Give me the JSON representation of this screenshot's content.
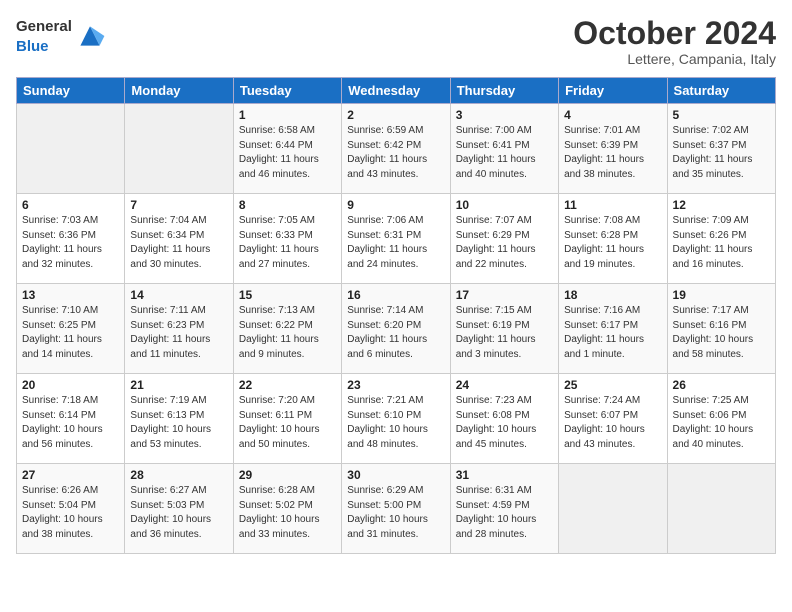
{
  "header": {
    "logo_general": "General",
    "logo_blue": "Blue",
    "month": "October 2024",
    "location": "Lettere, Campania, Italy"
  },
  "days_of_week": [
    "Sunday",
    "Monday",
    "Tuesday",
    "Wednesday",
    "Thursday",
    "Friday",
    "Saturday"
  ],
  "weeks": [
    [
      {
        "num": "",
        "info": ""
      },
      {
        "num": "",
        "info": ""
      },
      {
        "num": "1",
        "info": "Sunrise: 6:58 AM\nSunset: 6:44 PM\nDaylight: 11 hours and 46 minutes."
      },
      {
        "num": "2",
        "info": "Sunrise: 6:59 AM\nSunset: 6:42 PM\nDaylight: 11 hours and 43 minutes."
      },
      {
        "num": "3",
        "info": "Sunrise: 7:00 AM\nSunset: 6:41 PM\nDaylight: 11 hours and 40 minutes."
      },
      {
        "num": "4",
        "info": "Sunrise: 7:01 AM\nSunset: 6:39 PM\nDaylight: 11 hours and 38 minutes."
      },
      {
        "num": "5",
        "info": "Sunrise: 7:02 AM\nSunset: 6:37 PM\nDaylight: 11 hours and 35 minutes."
      }
    ],
    [
      {
        "num": "6",
        "info": "Sunrise: 7:03 AM\nSunset: 6:36 PM\nDaylight: 11 hours and 32 minutes."
      },
      {
        "num": "7",
        "info": "Sunrise: 7:04 AM\nSunset: 6:34 PM\nDaylight: 11 hours and 30 minutes."
      },
      {
        "num": "8",
        "info": "Sunrise: 7:05 AM\nSunset: 6:33 PM\nDaylight: 11 hours and 27 minutes."
      },
      {
        "num": "9",
        "info": "Sunrise: 7:06 AM\nSunset: 6:31 PM\nDaylight: 11 hours and 24 minutes."
      },
      {
        "num": "10",
        "info": "Sunrise: 7:07 AM\nSunset: 6:29 PM\nDaylight: 11 hours and 22 minutes."
      },
      {
        "num": "11",
        "info": "Sunrise: 7:08 AM\nSunset: 6:28 PM\nDaylight: 11 hours and 19 minutes."
      },
      {
        "num": "12",
        "info": "Sunrise: 7:09 AM\nSunset: 6:26 PM\nDaylight: 11 hours and 16 minutes."
      }
    ],
    [
      {
        "num": "13",
        "info": "Sunrise: 7:10 AM\nSunset: 6:25 PM\nDaylight: 11 hours and 14 minutes."
      },
      {
        "num": "14",
        "info": "Sunrise: 7:11 AM\nSunset: 6:23 PM\nDaylight: 11 hours and 11 minutes."
      },
      {
        "num": "15",
        "info": "Sunrise: 7:13 AM\nSunset: 6:22 PM\nDaylight: 11 hours and 9 minutes."
      },
      {
        "num": "16",
        "info": "Sunrise: 7:14 AM\nSunset: 6:20 PM\nDaylight: 11 hours and 6 minutes."
      },
      {
        "num": "17",
        "info": "Sunrise: 7:15 AM\nSunset: 6:19 PM\nDaylight: 11 hours and 3 minutes."
      },
      {
        "num": "18",
        "info": "Sunrise: 7:16 AM\nSunset: 6:17 PM\nDaylight: 11 hours and 1 minute."
      },
      {
        "num": "19",
        "info": "Sunrise: 7:17 AM\nSunset: 6:16 PM\nDaylight: 10 hours and 58 minutes."
      }
    ],
    [
      {
        "num": "20",
        "info": "Sunrise: 7:18 AM\nSunset: 6:14 PM\nDaylight: 10 hours and 56 minutes."
      },
      {
        "num": "21",
        "info": "Sunrise: 7:19 AM\nSunset: 6:13 PM\nDaylight: 10 hours and 53 minutes."
      },
      {
        "num": "22",
        "info": "Sunrise: 7:20 AM\nSunset: 6:11 PM\nDaylight: 10 hours and 50 minutes."
      },
      {
        "num": "23",
        "info": "Sunrise: 7:21 AM\nSunset: 6:10 PM\nDaylight: 10 hours and 48 minutes."
      },
      {
        "num": "24",
        "info": "Sunrise: 7:23 AM\nSunset: 6:08 PM\nDaylight: 10 hours and 45 minutes."
      },
      {
        "num": "25",
        "info": "Sunrise: 7:24 AM\nSunset: 6:07 PM\nDaylight: 10 hours and 43 minutes."
      },
      {
        "num": "26",
        "info": "Sunrise: 7:25 AM\nSunset: 6:06 PM\nDaylight: 10 hours and 40 minutes."
      }
    ],
    [
      {
        "num": "27",
        "info": "Sunrise: 6:26 AM\nSunset: 5:04 PM\nDaylight: 10 hours and 38 minutes."
      },
      {
        "num": "28",
        "info": "Sunrise: 6:27 AM\nSunset: 5:03 PM\nDaylight: 10 hours and 36 minutes."
      },
      {
        "num": "29",
        "info": "Sunrise: 6:28 AM\nSunset: 5:02 PM\nDaylight: 10 hours and 33 minutes."
      },
      {
        "num": "30",
        "info": "Sunrise: 6:29 AM\nSunset: 5:00 PM\nDaylight: 10 hours and 31 minutes."
      },
      {
        "num": "31",
        "info": "Sunrise: 6:31 AM\nSunset: 4:59 PM\nDaylight: 10 hours and 28 minutes."
      },
      {
        "num": "",
        "info": ""
      },
      {
        "num": "",
        "info": ""
      }
    ]
  ]
}
